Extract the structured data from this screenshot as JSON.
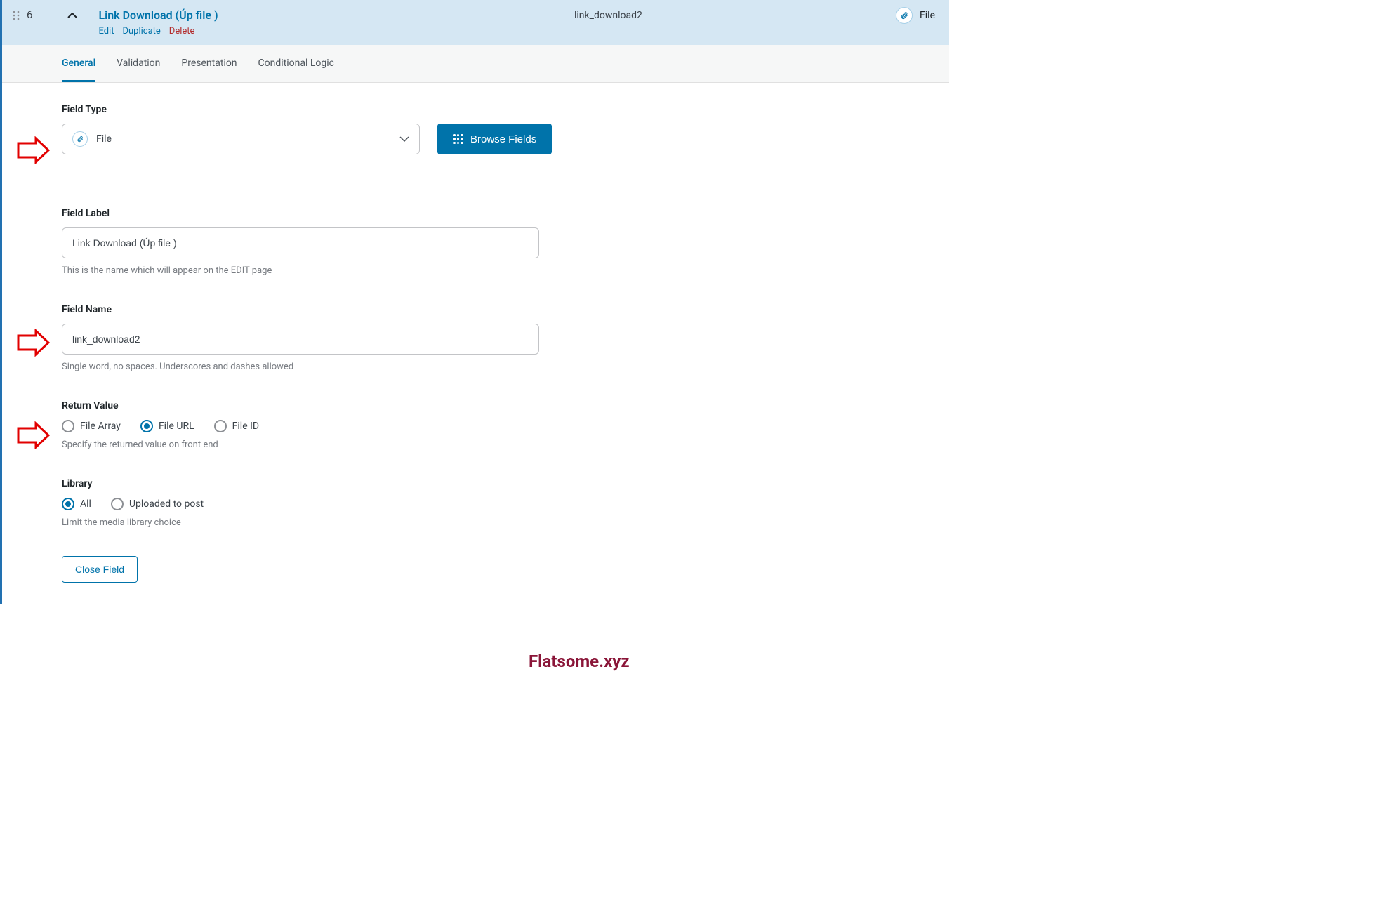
{
  "header": {
    "number": "6",
    "title": "Link Download (Úp file )",
    "actions": {
      "edit": "Edit",
      "duplicate": "Duplicate",
      "delete": "Delete"
    },
    "name": "link_download2",
    "type_label": "File"
  },
  "tabs": [
    {
      "label": "General",
      "active": true
    },
    {
      "label": "Validation",
      "active": false
    },
    {
      "label": "Presentation",
      "active": false
    },
    {
      "label": "Conditional Logic",
      "active": false
    }
  ],
  "field_type": {
    "label": "Field Type",
    "value": "File",
    "browse_label": "Browse Fields"
  },
  "field_label": {
    "label": "Field Label",
    "value": "Link Download (Úp file )",
    "hint": "This is the name which will appear on the EDIT page"
  },
  "field_name": {
    "label": "Field Name",
    "value": "link_download2",
    "hint": "Single word, no spaces. Underscores and dashes allowed"
  },
  "return_value": {
    "label": "Return Value",
    "options": [
      {
        "label": "File Array",
        "checked": false
      },
      {
        "label": "File URL",
        "checked": true
      },
      {
        "label": "File ID",
        "checked": false
      }
    ],
    "hint": "Specify the returned value on front end"
  },
  "library": {
    "label": "Library",
    "options": [
      {
        "label": "All",
        "checked": true
      },
      {
        "label": "Uploaded to post",
        "checked": false
      }
    ],
    "hint": "Limit the media library choice"
  },
  "close_label": "Close Field",
  "watermark": "Flatsome.xyz"
}
